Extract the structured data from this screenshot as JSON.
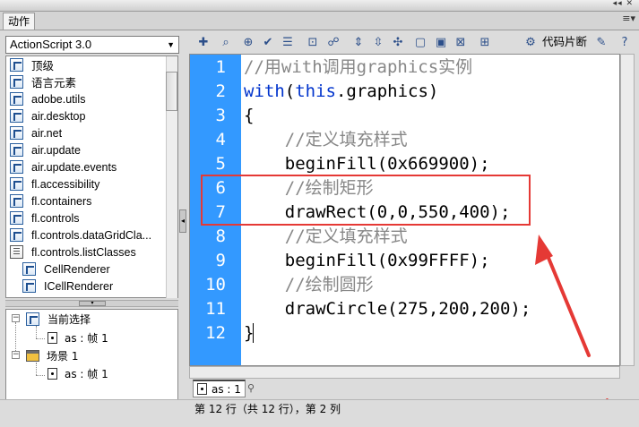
{
  "panel": {
    "tab_label": "动作",
    "window_controls": "◂◂ ✕",
    "menu_glyph": "≡▾"
  },
  "language_select": {
    "value": "ActionScript 3.0"
  },
  "toolbox": {
    "items": [
      {
        "label": "顶级",
        "icon": "class-icon"
      },
      {
        "label": "语言元素",
        "icon": "class-icon"
      },
      {
        "label": "adobe.utils",
        "icon": "class-icon"
      },
      {
        "label": "air.desktop",
        "icon": "class-icon"
      },
      {
        "label": "air.net",
        "icon": "class-icon"
      },
      {
        "label": "air.update",
        "icon": "class-icon"
      },
      {
        "label": "air.update.events",
        "icon": "class-icon"
      },
      {
        "label": "fl.accessibility",
        "icon": "class-icon"
      },
      {
        "label": "fl.containers",
        "icon": "class-icon"
      },
      {
        "label": "fl.controls",
        "icon": "class-icon"
      },
      {
        "label": "fl.controls.dataGridCla...",
        "icon": "class-icon"
      },
      {
        "label": "fl.controls.listClasses",
        "icon": "book-icon"
      },
      {
        "label": "CellRenderer",
        "icon": "class-icon"
      },
      {
        "label": "ICellRenderer",
        "icon": "class-icon"
      }
    ]
  },
  "script_nav": {
    "current_selection": "当前选择",
    "current_frame": "as : 帧 1",
    "scene": "场景 1",
    "scene_frame": "as : 帧 1"
  },
  "script_toolbar": {
    "icons": [
      "add-icon",
      "find-icon",
      "target-icon",
      "check-syntax-icon",
      "auto-format-icon",
      "code-hint-icon",
      "debug-icon",
      "collapse-braces-icon",
      "collapse-selection-icon",
      "expand-all-icon",
      "comment-block-icon",
      "comment-line-icon",
      "uncomment-icon",
      "toolbox-toggle-icon"
    ],
    "snippets_label": "代码片断",
    "assist_icon": "wand-icon"
  },
  "editor": {
    "line_numbers": [
      "1",
      "2",
      "3",
      "4",
      "5",
      "6",
      "7",
      "8",
      "9",
      "10",
      "11",
      "12"
    ],
    "lines": [
      "//用with调用graphics实例",
      "with(this.graphics)",
      "{",
      "    //定义填充样式",
      "    beginFill(0x669900);",
      "    //绘制矩形",
      "    drawRect(0,0,550,400);",
      "    //定义填充样式",
      "    beginFill(0x99FFFF);",
      "    //绘制圆形",
      "    drawCircle(275,200,200);",
      "}"
    ],
    "with_keyword": "with",
    "this_keyword": "this",
    "with_rest": "(",
    "with_tail": ".graphics)"
  },
  "tabs": {
    "file_tab": "as : 1"
  },
  "status": {
    "text": "第 12 行（共 12 行），第 2 列"
  },
  "colors": {
    "gutter": "#3399ff",
    "comment": "#878787",
    "keyword": "#0033cc",
    "annotation": "#e53935"
  }
}
